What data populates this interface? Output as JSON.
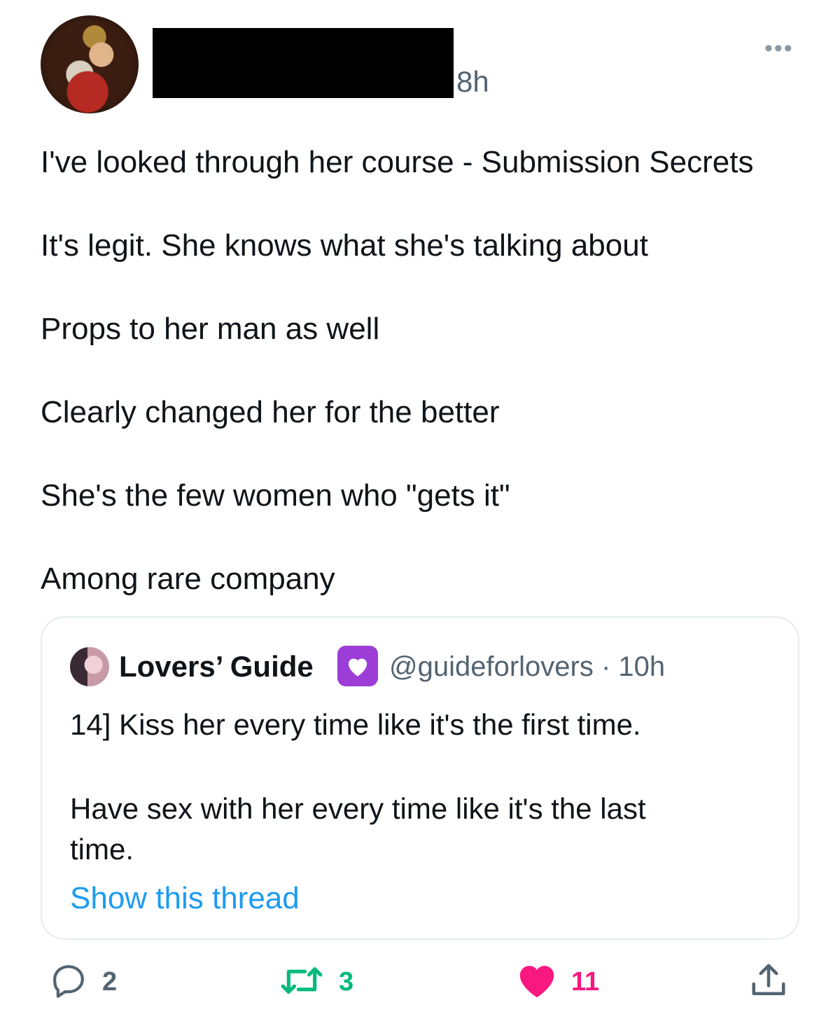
{
  "tweet": {
    "time": "8h",
    "more_icon": "more-icon",
    "lines": [
      "I've looked through her course - Submission Secrets",
      "It's legit. She knows what she's talking about",
      "Props to her man as well",
      "Clearly changed her for the better",
      "She's the few women who \"gets it\"",
      "Among rare company"
    ]
  },
  "quote": {
    "name": "Lovers’ Guide",
    "badge_icon": "purple-heart-icon",
    "handle_time": "@guideforlovers · 10h",
    "lines": [
      "14] Kiss her every time like it's the first time.",
      "Have sex with her every time like it's the last",
      "time."
    ],
    "show_thread": "Show this thread"
  },
  "actions": {
    "reply_count": "2",
    "retweet_count": "3",
    "like_count": "11"
  },
  "colors": {
    "link": "#1d9bf0",
    "retweet": "#00ba7c",
    "like": "#f91880",
    "muted": "#536471"
  }
}
